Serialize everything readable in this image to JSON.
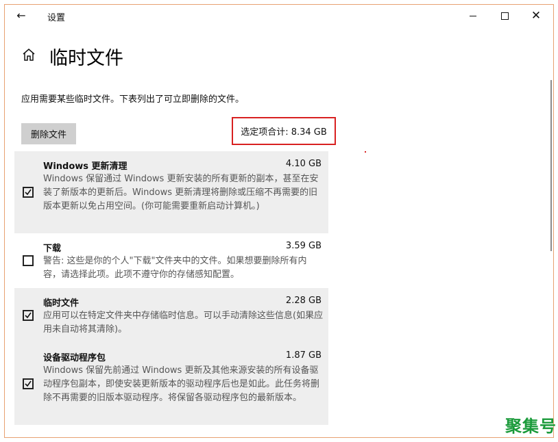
{
  "window": {
    "title": "设置",
    "back_icon": "←",
    "close_icon": "✕"
  },
  "header": {
    "title": "临时文件",
    "description": "应用需要某些临时文件。下表列出了可立即删除的文件。"
  },
  "toolbar": {
    "delete_label": "删除文件",
    "total_label": "选定项合计: 8.34 GB"
  },
  "items": [
    {
      "name": "Windows 更新清理",
      "size": "4.10 GB",
      "checked": true,
      "description": "Windows 保留通过 Windows 更新安装的所有更新的副本，甚至在安装了新版本的更新后。Windows 更新清理将删除或压缩不再需要的旧版本更新以免占用空间。(你可能需要重新启动计算机。)"
    },
    {
      "name": "下载",
      "size": "3.59 GB",
      "checked": false,
      "description": "警告: 这些是你的个人\"下载\"文件夹中的文件。如果想要删除所有内容，请选择此项。此项不遵守你的存储感知配置。"
    },
    {
      "name": "临时文件",
      "size": "2.28 GB",
      "checked": true,
      "description": "应用可以在特定文件夹中存储临时信息。可以手动清除这些信息(如果应用未自动将其清除)。"
    },
    {
      "name": "设备驱动程序包",
      "size": "1.87 GB",
      "checked": true,
      "description": "Windows 保留先前通过 Windows 更新及其他来源安装的所有设备驱动程序包副本，即使安装更新版本的驱动程序后也是如此。此任务将删除不再需要的旧版本驱动程序。将保留各驱动程序包的最新版本。"
    }
  ],
  "watermark": "聚集号",
  "colors": {
    "highlight_border": "#d82020",
    "selected_row": "#eeeeee",
    "watermark": "#1a9a3a"
  }
}
